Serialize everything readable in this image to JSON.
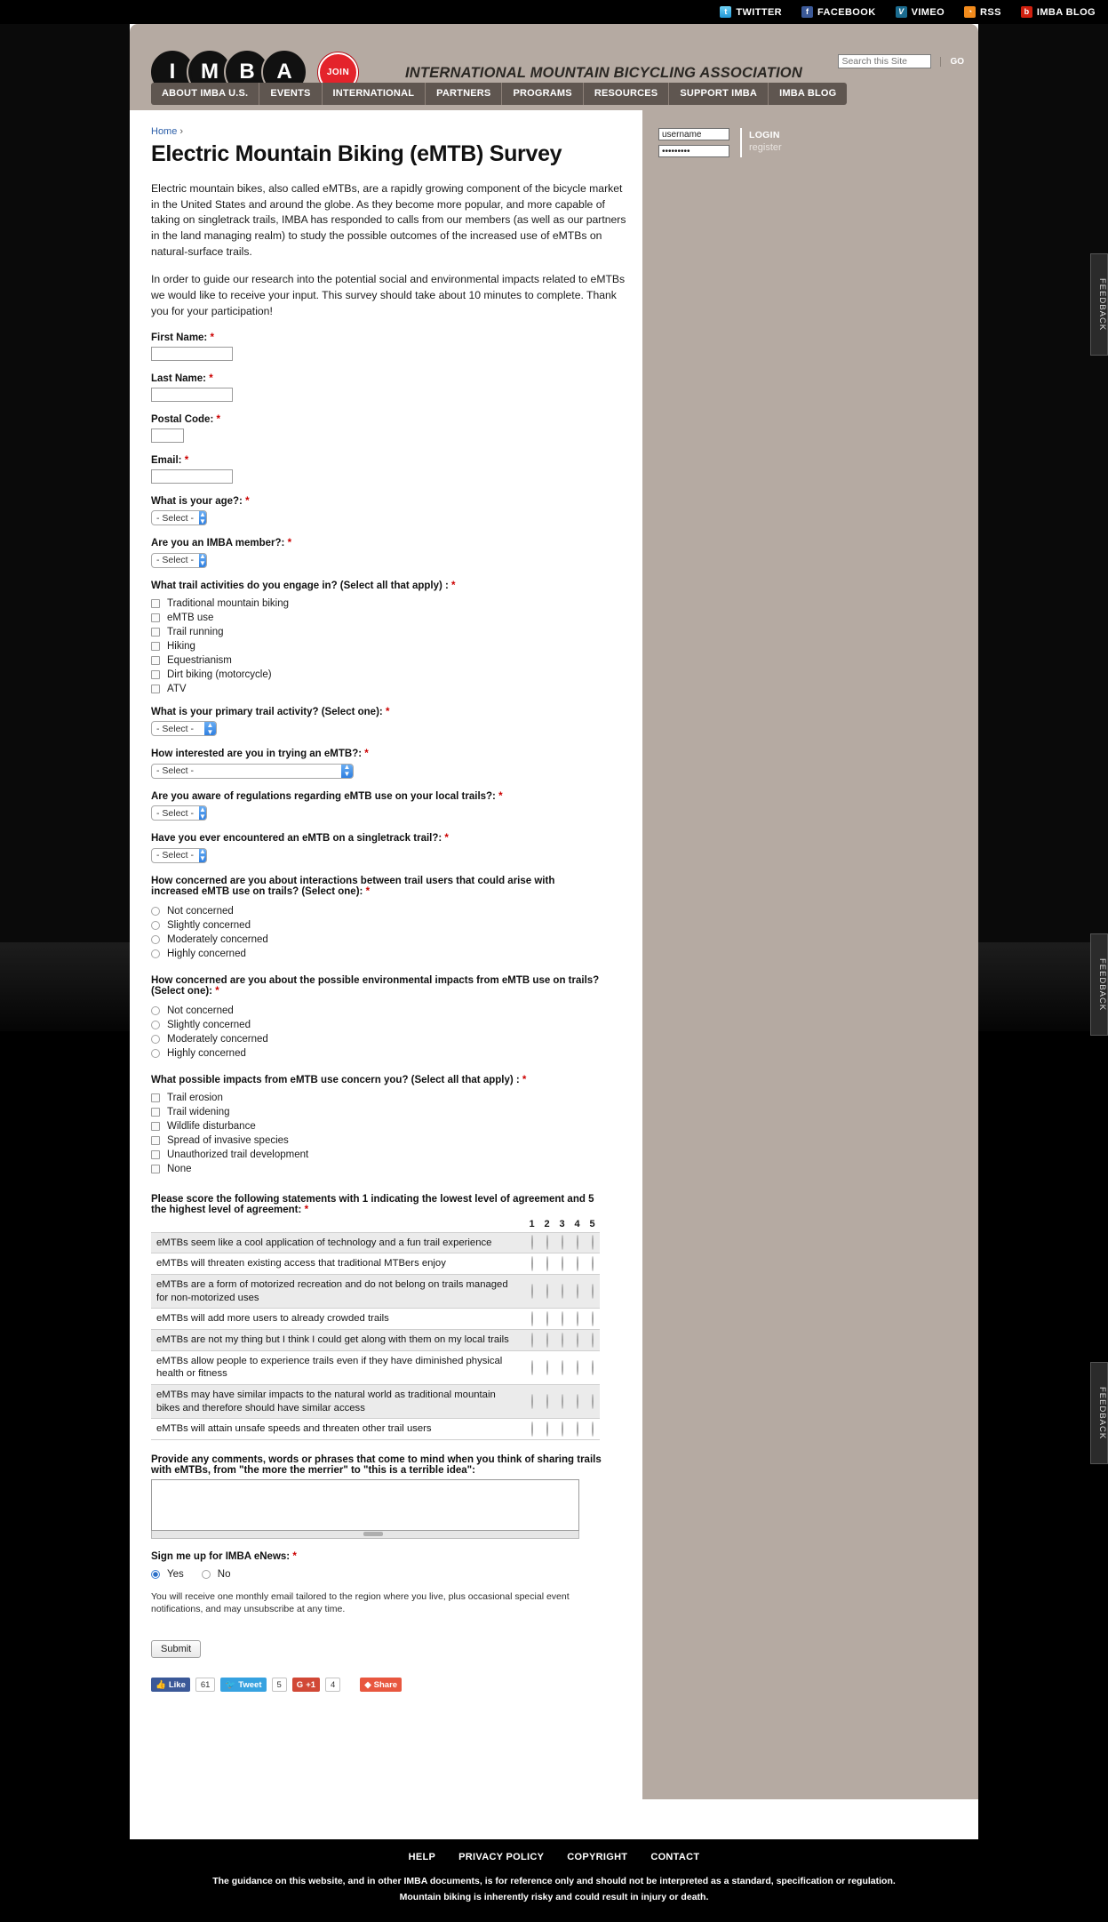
{
  "social": {
    "links": [
      {
        "label": "TWITTER",
        "icon": "twitter-icon",
        "glyph": "t"
      },
      {
        "label": "FACEBOOK",
        "icon": "facebook-icon",
        "glyph": "f"
      },
      {
        "label": "VIMEO",
        "icon": "vimeo-icon",
        "glyph": "V"
      },
      {
        "label": "RSS",
        "icon": "rss-icon",
        "glyph": "◔"
      },
      {
        "label": "IMBA BLOG",
        "icon": "blog-icon",
        "glyph": "b"
      }
    ]
  },
  "header": {
    "logo_letters": [
      "I",
      "M",
      "B",
      "A"
    ],
    "join_label": "JOIN",
    "org_title": "INTERNATIONAL MOUNTAIN BICYCLING ASSOCIATION",
    "search_placeholder": "Search this Site",
    "search_value": "",
    "go_label": "GO",
    "nav": [
      "ABOUT IMBA U.S.",
      "EVENTS",
      "INTERNATIONAL",
      "PARTNERS",
      "PROGRAMS",
      "RESOURCES",
      "SUPPORT IMBA",
      "IMBA BLOG"
    ]
  },
  "login": {
    "username_value": "username",
    "password_value": "•••••••••",
    "login_label": "LOGIN",
    "register_label": "register"
  },
  "breadcrumb": {
    "home": "Home",
    "separator": "›"
  },
  "page": {
    "title": "Electric Mountain Biking (eMTB) Survey",
    "intro_1": "Electric mountain bikes, also called eMTBs, are a rapidly growing component of the bicycle market in the United States and around the globe. As they become more popular, and more capable of taking on singletrack trails, IMBA has responded to calls from our members (as well as our partners in the land managing realm) to study the possible outcomes of the increased use of eMTBs on natural-surface trails.",
    "intro_2": "In order to guide our research into the potential social and environmental impacts related to eMTBs we would like to receive your input. This survey should take about 10 minutes to complete. Thank you for your participation!"
  },
  "form": {
    "required_mark": "*",
    "select_placeholder": "- Select -",
    "first_name_label": "First Name:",
    "first_name_value": "",
    "last_name_label": "Last Name:",
    "last_name_value": "",
    "postal_label": "Postal Code:",
    "postal_value": "",
    "email_label": "Email:",
    "email_value": "",
    "age_label": "What is your age?:",
    "member_label": "Are you an IMBA member?:",
    "activities_label": "What trail activities do you engage in? (Select all that apply) :",
    "activities": [
      "Traditional mountain biking",
      "eMTB use",
      "Trail running",
      "Hiking",
      "Equestrianism",
      "Dirt biking (motorcycle)",
      "ATV"
    ],
    "primary_label": "What is your primary trail activity? (Select one):",
    "interest_label": "How interested are you in trying an eMTB?:",
    "regulations_label": "Are you aware of regulations regarding eMTB use on your local trails?:",
    "encountered_label": "Have you ever encountered an eMTB on a singletrack trail?:",
    "concern_interactions_label": "How concerned are you about interactions between trail users that could arise with increased eMTB use on trails? (Select one):",
    "concern_environment_label": "How concerned are you about the possible environmental impacts from eMTB use on trails? (Select one):",
    "concern_options": [
      "Not concerned",
      "Slightly concerned",
      "Moderately concerned",
      "Highly concerned"
    ],
    "impacts_label": "What possible impacts from eMTB use concern you? (Select all that apply) :",
    "impacts": [
      "Trail erosion",
      "Trail widening",
      "Wildlife disturbance",
      "Spread of invasive species",
      "Unauthorized trail development",
      "None"
    ],
    "score_label": "Please score the following statements with 1 indicating the lowest level of agreement and 5 the highest level of agreement:",
    "score_columns": [
      "1",
      "2",
      "3",
      "4",
      "5"
    ],
    "score_statements": [
      "eMTBs seem like a cool application of technology and a fun trail experience",
      "eMTBs will threaten existing access that traditional MTBers enjoy",
      "eMTBs are a form of motorized recreation and do not belong on trails managed for non-motorized uses",
      "eMTBs will add more users to already crowded trails",
      "eMTBs are not my thing but I think I could get along with them on my local trails",
      "eMTBs allow people to experience trails even if they have diminished physical health or fitness",
      "eMTBs may have similar impacts to the natural world as traditional mountain bikes and therefore should have similar access",
      "eMTBs will attain unsafe speeds and threaten other trail users"
    ],
    "comments_label": "Provide any comments, words or phrases that come to mind when you think of sharing trails with eMTBs, from \"the more the merrier\" to \"this is a terrible idea\":",
    "comments_value": "",
    "enews_label": "Sign me up for IMBA eNews:",
    "enews_options": [
      "Yes",
      "No"
    ],
    "enews_selected": "Yes",
    "enews_note": "You will receive one monthly email tailored to the region where you live, plus occasional special event notifications, and may unsubscribe at any time.",
    "submit_label": "Submit"
  },
  "share": {
    "facebook_label": "Like",
    "facebook_count": "61",
    "twitter_label": "Tweet",
    "twitter_count": "5",
    "google_label": "+1",
    "google_count": "4",
    "share_label": "Share"
  },
  "feedback": {
    "label": "FEEDBACK"
  },
  "footer": {
    "links": [
      "HELP",
      "PRIVACY POLICY",
      "COPYRIGHT",
      "CONTACT"
    ],
    "disclaimer_1": "The guidance on this website, and in other IMBA documents, is for reference only and should not be interpreted as a standard, specification or regulation.",
    "disclaimer_2": "Mountain biking is inherently risky and could result in injury or death."
  },
  "colors": {
    "brand_red": "#e4232b",
    "header_tan": "#b5aaa2",
    "nav_brown": "#5f5650",
    "link_blue": "#2b5ea8"
  }
}
